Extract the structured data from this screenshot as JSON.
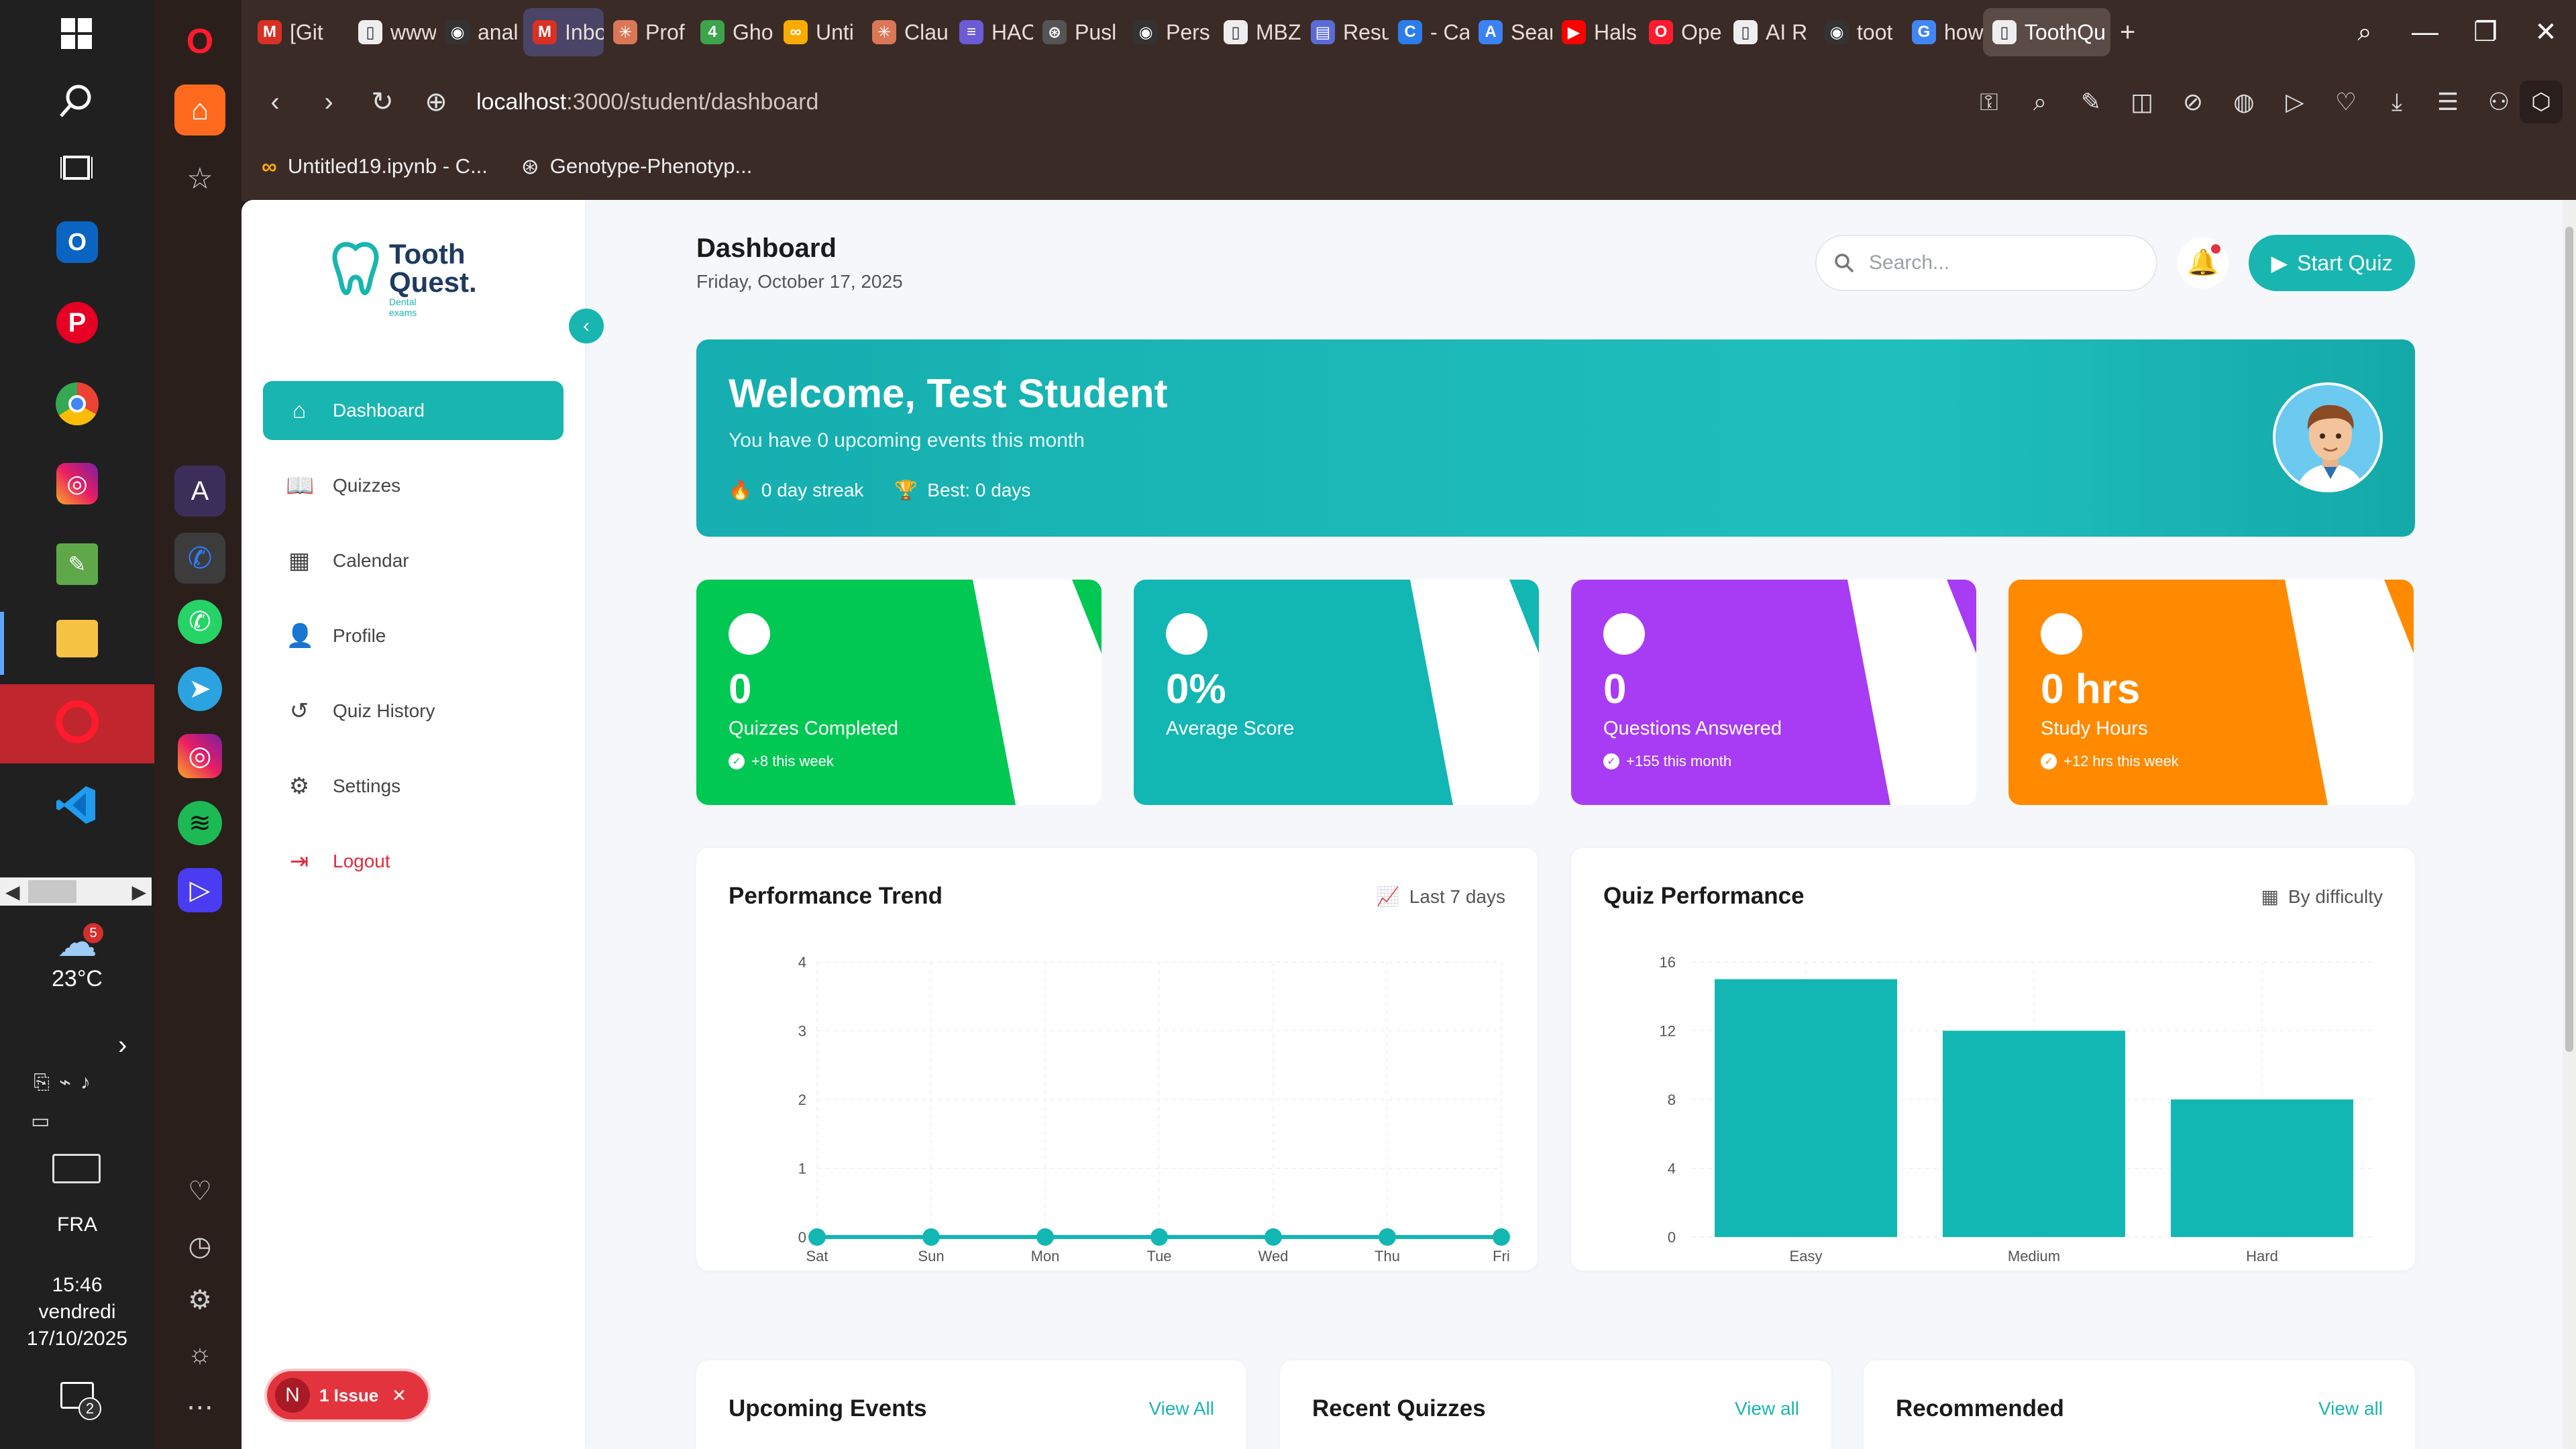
{
  "taskbar": {
    "weather_temp": "23°C",
    "weather_badge": "5",
    "language": "FRA",
    "time": "15:46",
    "day": "vendredi",
    "date": "17/10/2025",
    "notifications": "2"
  },
  "browser": {
    "tabs": [
      {
        "label": "[Git",
        "color": "#d93025",
        "fav": "M"
      },
      {
        "label": "www",
        "color": "#eeeeee",
        "fav": "▯"
      },
      {
        "label": "anal",
        "color": "#333333",
        "fav": "◉"
      },
      {
        "label": "Inbo",
        "color": "#d93025",
        "fav": "M",
        "highlight": true
      },
      {
        "label": "Prof",
        "color": "#d97757",
        "fav": "✳"
      },
      {
        "label": "Gho",
        "color": "#3da34d",
        "fav": "4"
      },
      {
        "label": "Unti",
        "color": "#f9ab00",
        "fav": "∞"
      },
      {
        "label": "Clau",
        "color": "#d97757",
        "fav": "✳"
      },
      {
        "label": "HAC",
        "color": "#6b5bd6",
        "fav": "≡"
      },
      {
        "label": "Pusl",
        "color": "#555555",
        "fav": "⊛"
      },
      {
        "label": "Pers",
        "color": "#333333",
        "fav": "◉"
      },
      {
        "label": "MBZ",
        "color": "#eeeeee",
        "fav": "▯"
      },
      {
        "label": "Resu",
        "color": "#5b6bd6",
        "fav": "▤"
      },
      {
        "label": "- Ca",
        "color": "#2b7de9",
        "fav": "C"
      },
      {
        "label": "Sear",
        "color": "#3b82f6",
        "fav": "A"
      },
      {
        "label": "Hals",
        "color": "#ff0000",
        "fav": "▶"
      },
      {
        "label": "Ope",
        "color": "#ff1b2d",
        "fav": "O"
      },
      {
        "label": "AI R",
        "color": "#eeeeee",
        "fav": "▯"
      },
      {
        "label": "toot",
        "color": "#333333",
        "fav": "◉"
      },
      {
        "label": "how",
        "color": "#4285f4",
        "fav": "G"
      },
      {
        "label": "ToothQu",
        "color": "#eeeeee",
        "fav": "▯",
        "active": true
      }
    ],
    "url_host": "localhost",
    "url_path": ":3000/student/dashboard",
    "bookmarks": [
      {
        "label": "Untitled19.ipynb - C...",
        "icon": "colab-icon"
      },
      {
        "label": "Genotype-Phenotyp...",
        "icon": "chatgpt-icon"
      }
    ]
  },
  "app": {
    "logo_line1": "Tooth",
    "logo_line2": "Quest.",
    "logo_tagline": "Dental exams",
    "nav": [
      {
        "label": "Dashboard",
        "icon": "home-icon",
        "glyph": "⌂",
        "active": true
      },
      {
        "label": "Quizzes",
        "icon": "book-icon",
        "glyph": "📖"
      },
      {
        "label": "Calendar",
        "icon": "calendar-icon",
        "glyph": "▦"
      },
      {
        "label": "Profile",
        "icon": "user-icon",
        "glyph": "👤"
      },
      {
        "label": "Quiz History",
        "icon": "history-icon",
        "glyph": "↺"
      },
      {
        "label": "Settings",
        "icon": "gear-icon",
        "glyph": "⚙"
      },
      {
        "label": "Logout",
        "icon": "logout-icon",
        "glyph": "⇥",
        "logout": true
      }
    ],
    "issue_badge": {
      "letter": "N",
      "label": "1 Issue",
      "close": "✕"
    }
  },
  "header": {
    "title": "Dashboard",
    "date": "Friday, October 17, 2025",
    "search_placeholder": "Search...",
    "start_quiz": "Start Quiz"
  },
  "welcome": {
    "title": "Welcome, Test Student",
    "subtitle": "You have 0 upcoming events this month",
    "streak": "0 day streak",
    "best": "Best: 0 days"
  },
  "stats": [
    {
      "value": "0",
      "label": "Quizzes Completed",
      "trend": "+8 this week",
      "color": "#00c853"
    },
    {
      "value": "0%",
      "label": "Average Score",
      "trend": "",
      "color": "#12b7b3"
    },
    {
      "value": "0",
      "label": "Questions Answered",
      "trend": "+155 this month",
      "color": "#a83cf5"
    },
    {
      "value": "0 hrs",
      "label": "Study Hours",
      "trend": "+12 hrs this week",
      "color": "#ff8a00"
    }
  ],
  "performance_panel": {
    "title": "Performance Trend",
    "meta": "Last 7 days"
  },
  "quiz_panel": {
    "title": "Quiz Performance",
    "meta": "By difficulty"
  },
  "bottom_panels": [
    {
      "title": "Upcoming Events",
      "link": "View All"
    },
    {
      "title": "Recent Quizzes",
      "link": "View all"
    },
    {
      "title": "Recommended",
      "link": "View all"
    }
  ],
  "chart_data": [
    {
      "type": "line",
      "categories": [
        "Sat",
        "Sun",
        "Mon",
        "Tue",
        "Wed",
        "Thu",
        "Fri"
      ],
      "values": [
        0,
        0,
        0,
        0,
        0,
        0,
        0
      ],
      "yticks": [
        0,
        1,
        2,
        3,
        4
      ],
      "ylim": [
        0,
        4
      ],
      "grid": true,
      "color": "#12b7b3"
    },
    {
      "type": "bar",
      "categories": [
        "Easy",
        "Medium",
        "Hard"
      ],
      "values": [
        15,
        12,
        8
      ],
      "yticks": [
        0,
        4,
        8,
        12,
        16
      ],
      "ylim": [
        0,
        16
      ],
      "grid": true,
      "color": "#12b7b3"
    }
  ]
}
